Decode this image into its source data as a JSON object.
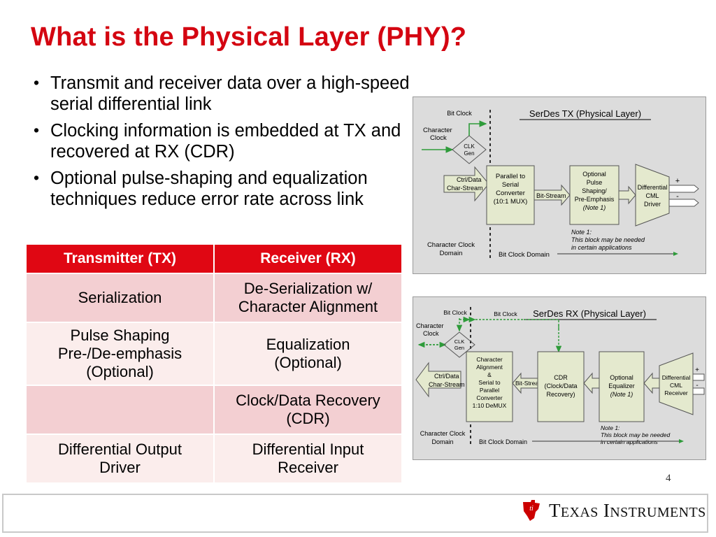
{
  "slide": {
    "title": "What is the Physical Layer (PHY)?",
    "page_number": "4",
    "title_color": "#D40511",
    "table_header_color": "#E00713",
    "row_shade_dark": "#F3CFD2",
    "row_shade_light": "#FBEDEC",
    "diagram_bg": "#DCDCDC",
    "block_fill": "#E4E9CE",
    "arrow_green": "#2E9B3A"
  },
  "bullets": [
    "Transmit and receiver data over a high-speed serial differential link",
    "Clocking information is embedded at TX and recovered at RX (CDR)",
    "Optional pulse-shaping and equalization techniques reduce error rate across link"
  ],
  "table": {
    "headers": [
      "Transmitter (TX)",
      "Receiver (RX)"
    ],
    "rows": [
      {
        "tx": "Serialization",
        "rx": "De-Serialization w/\nCharacter Alignment"
      },
      {
        "tx": "Pulse Shaping\nPre-/De-emphasis\n(Optional)",
        "rx": "Equalization\n(Optional)"
      },
      {
        "tx": "",
        "rx": "Clock/Data Recovery\n(CDR)"
      },
      {
        "tx": "Differential Output\nDriver",
        "rx": "Differential Input\nReceiver"
      }
    ]
  },
  "diagram_tx": {
    "title": "SerDes TX (Physical Layer)",
    "labels": {
      "character_clock": "Character\nClock",
      "clk_gen": "CLK\nGen",
      "bit_clock": "Bit Clock",
      "char_stream": "Ctrl/Data\nChar-Stream",
      "block1": "Parallel to\nSerial\nConverter\n(10:1 MUX)",
      "bit_stream": "Bit-Stream",
      "block2": "Optional\nPulse\nShaping/\nPre-Emphasis\n(Note 1)",
      "block3": "Differential\nCML\nDriver",
      "plus": "+",
      "minus": "-",
      "note": "Note 1:\nThis block may be needed\nin certain applications",
      "char_clock_domain": "Character Clock\nDomain",
      "bit_clock_domain": "Bit Clock Domain"
    }
  },
  "diagram_rx": {
    "title": "SerDes RX (Physical Layer)",
    "labels": {
      "character_clock": "Character\nClock",
      "clk_gen": "CLK\nGen",
      "bit_clock_left": "Bit Clock",
      "bit_clock_right": "Bit Clock",
      "char_stream": "Ctrl/Data\nChar-Stream",
      "block1": "Character\nAlignment\n&\nSerial to\nParallel\nConverter\n1:10 DeMUX",
      "bit_stream": "Bit-Stream",
      "block2": "CDR\n(Clock/Data\nRecovery)",
      "block3": "Optional\nEqualizer\n(Note 1)",
      "block4": "Differential\nCML\nReceiver",
      "plus": "+",
      "minus": "-",
      "note": "Note 1:\nThis block may be needed\nin certain applications",
      "char_clock_domain": "Character Clock\nDomain",
      "bit_clock_domain": "Bit Clock Domain"
    }
  },
  "footer": {
    "brand_first": "T",
    "brand_first_rest": "EXAS",
    "brand_second": "I",
    "brand_second_rest": "NSTRUMENTS"
  }
}
